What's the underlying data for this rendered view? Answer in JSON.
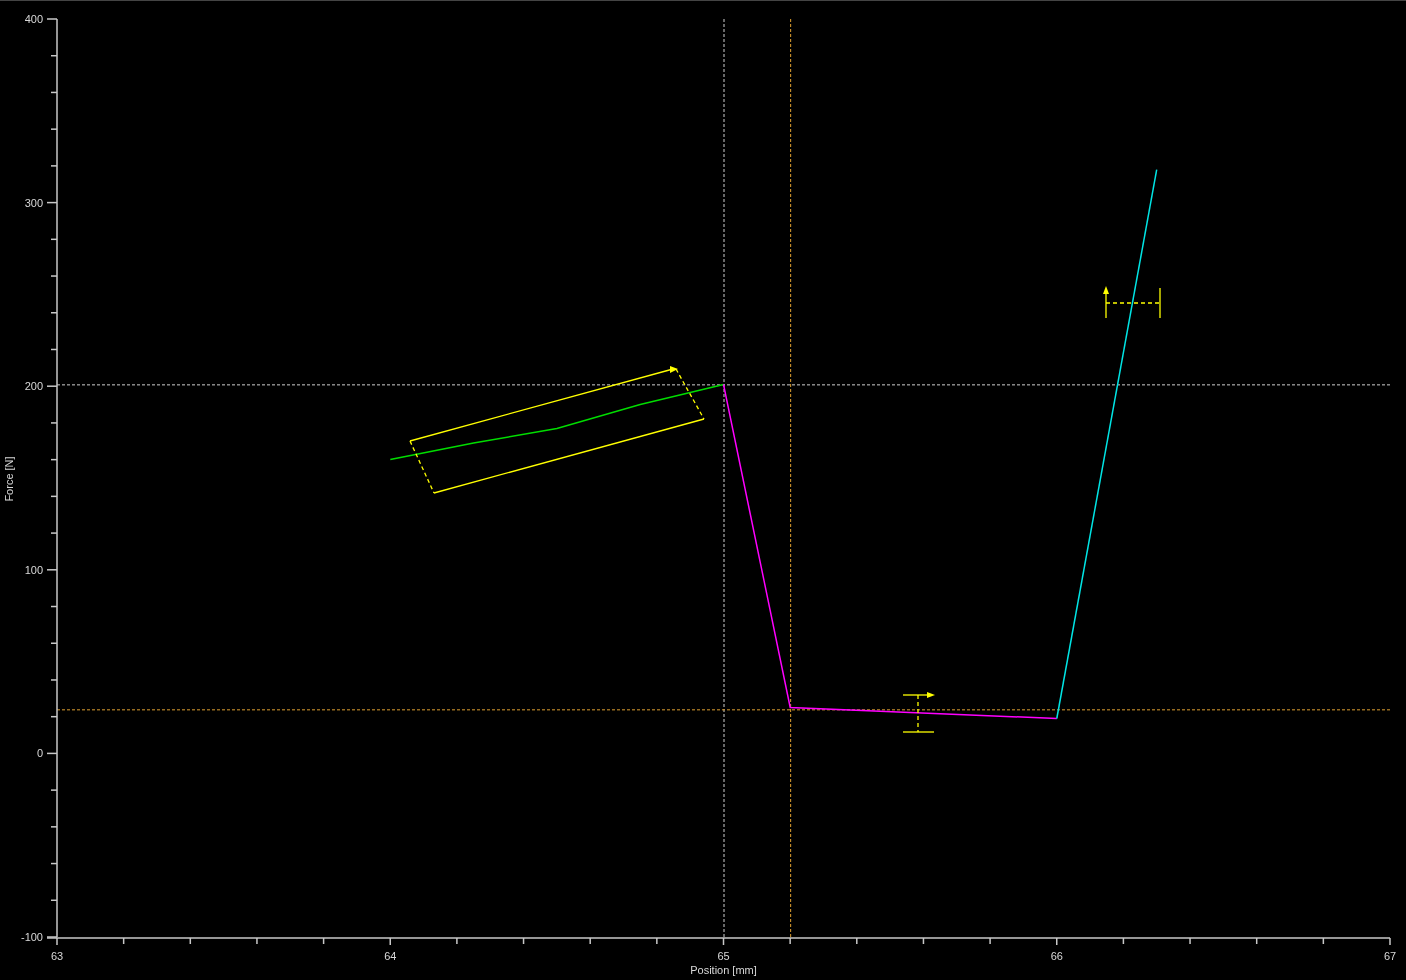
{
  "chart_data": {
    "type": "line",
    "xlabel": "Position [mm]",
    "ylabel": "Force [N]",
    "x": [
      64.0,
      64.25,
      64.5,
      64.75,
      65.0,
      65.2,
      66.0,
      66.3
    ],
    "series": [
      {
        "color": "#00dd00",
        "values": [
          160,
          169,
          177,
          190,
          201,
          null,
          null,
          null
        ]
      },
      {
        "color": "#ff00ff",
        "values": [
          null,
          null,
          null,
          null,
          201,
          25,
          19,
          null
        ]
      },
      {
        "color": "#00e5e5",
        "values": [
          null,
          null,
          null,
          null,
          null,
          null,
          19,
          318
        ]
      }
    ],
    "xlim": [
      63,
      67
    ],
    "ylim": [
      -100,
      400
    ],
    "xticks": [
      63,
      64,
      65,
      66,
      67
    ],
    "yticks": [
      -100,
      0,
      100,
      200,
      300,
      400
    ],
    "ref_lines": [
      {
        "axis": "x",
        "value": 65.0,
        "color": "#d0d0d0"
      },
      {
        "axis": "x",
        "value": 65.2,
        "color": "#e0a030"
      },
      {
        "axis": "y",
        "value": 201,
        "color": "#d0d0d0"
      },
      {
        "axis": "y",
        "value": 24,
        "color": "#e0a030"
      }
    ]
  }
}
